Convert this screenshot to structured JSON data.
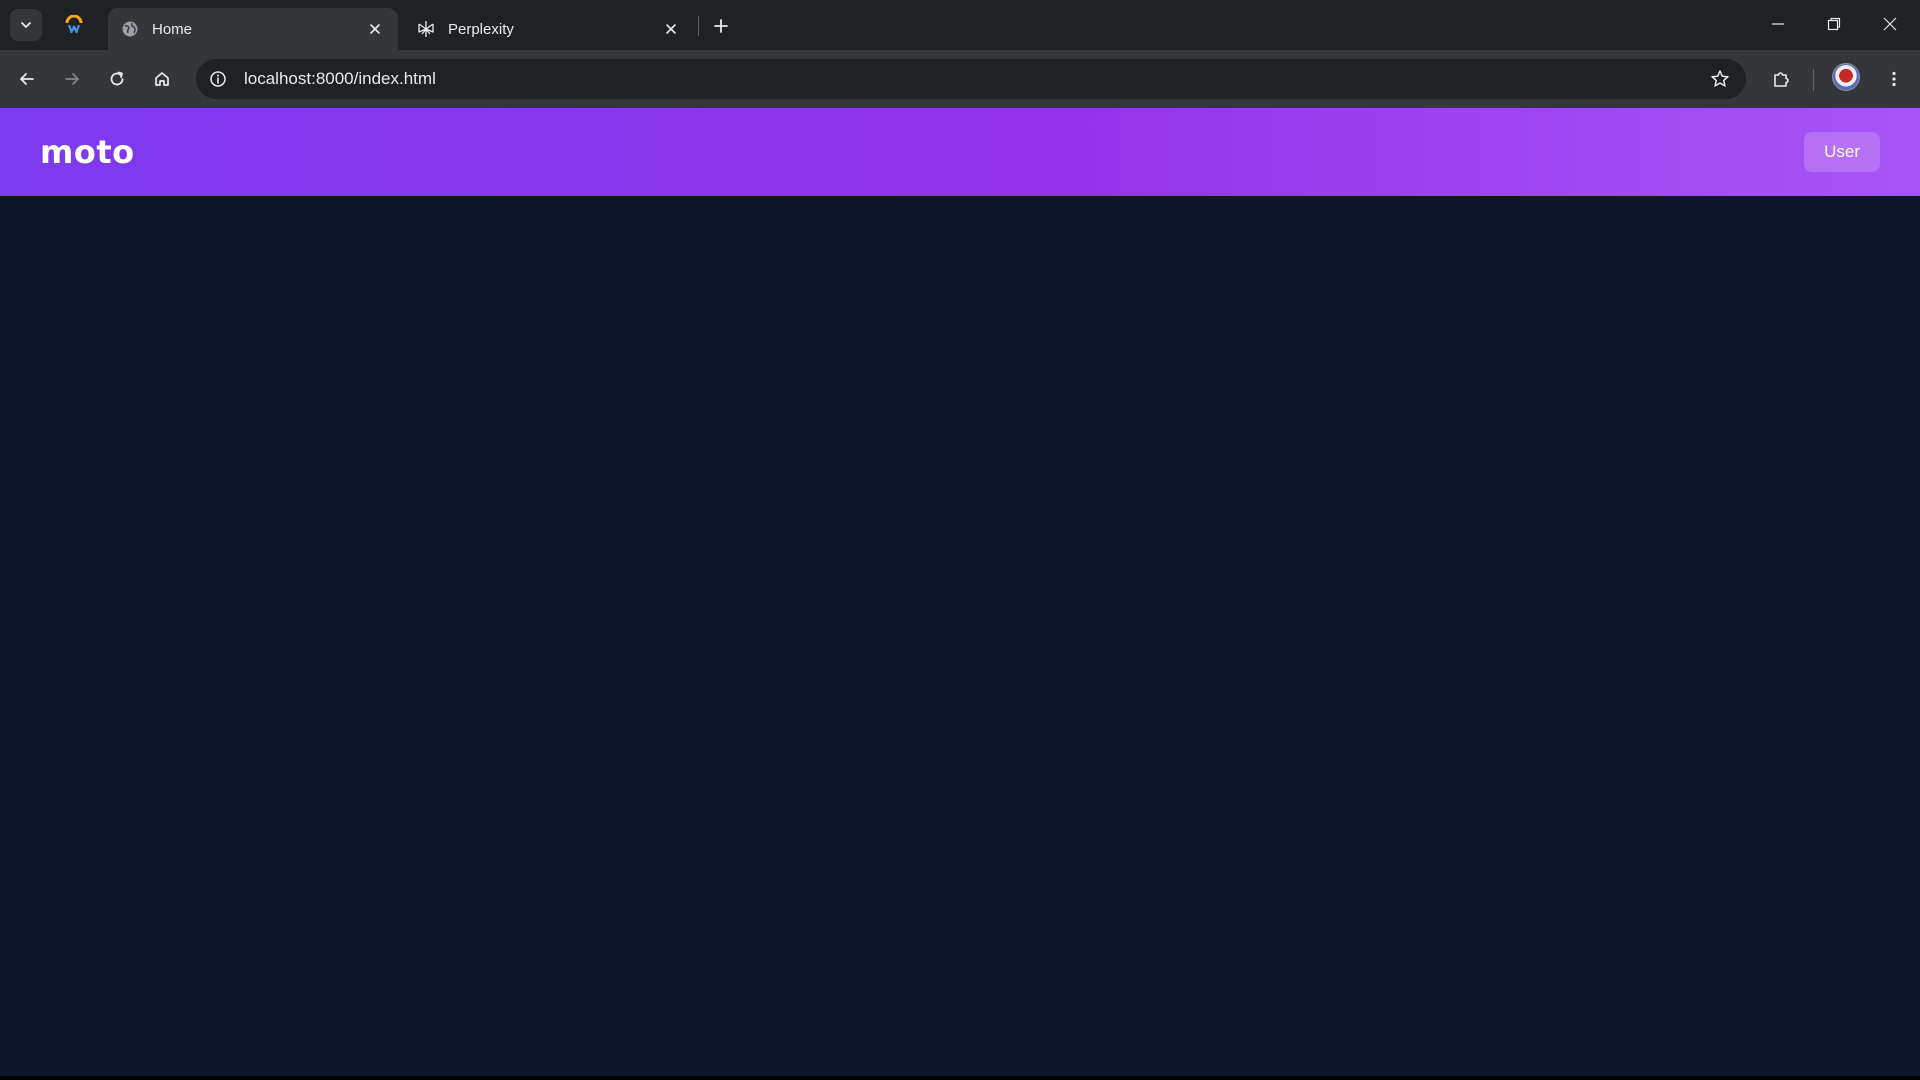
{
  "browser": {
    "tabs": [
      {
        "title": "Home",
        "active": true
      },
      {
        "title": "Perplexity",
        "active": false
      }
    ],
    "address_bar": {
      "url": "localhost:8000/index.html"
    }
  },
  "app": {
    "brand": "moto",
    "user_button": "User",
    "colors": {
      "header_gradient_start": "#7c3aed",
      "header_gradient_end": "#a855f7",
      "page_background": "#0e1629"
    }
  }
}
